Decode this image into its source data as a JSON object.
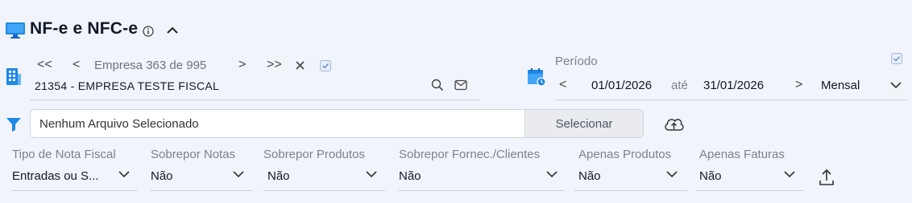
{
  "header": {
    "title": "NF-e e NFC-e",
    "icon": "monitor-icon",
    "info_icon": "info-icon",
    "collapse_icon": "chevron-up-icon"
  },
  "company": {
    "nav_first": "<<",
    "nav_prev": "<",
    "position_text": "Empresa 363 de 995",
    "nav_next": ">",
    "nav_last": ">>",
    "clear_icon": "close-icon",
    "checked": true,
    "selected": "21354 - EMPRESA TESTE FISCAL",
    "building_icon": "building-icon",
    "search_icon": "search-icon",
    "mail_icon": "mail-icon"
  },
  "period": {
    "label": "Período",
    "start": "01/01/2026",
    "separator": "até",
    "end": "31/01/2026",
    "mode": "Mensal",
    "checked": true,
    "calendar_icon": "calendar-icon"
  },
  "file": {
    "placeholder": "Nenhum Arquivo Selecionado",
    "button": "Selecionar",
    "filter_icon": "filter-icon",
    "upload_icon": "cloud-upload-icon"
  },
  "filters": [
    {
      "label": "Tipo de Nota Fiscal",
      "value": "Entradas ou S..."
    },
    {
      "label": "Sobrepor Notas",
      "value": "Não"
    },
    {
      "label": "Sobrepor Produtos",
      "value": "Não"
    },
    {
      "label": "Sobrepor Fornec./Clientes",
      "value": "Não"
    },
    {
      "label": "Apenas Produtos",
      "value": "Não"
    },
    {
      "label": "Apenas Faturas",
      "value": "Não"
    }
  ],
  "export_icon": "upload-icon",
  "colors": {
    "background": "#f1f4fa",
    "accent": "#1e88e5",
    "text": "#111827",
    "muted": "#7b8190"
  }
}
